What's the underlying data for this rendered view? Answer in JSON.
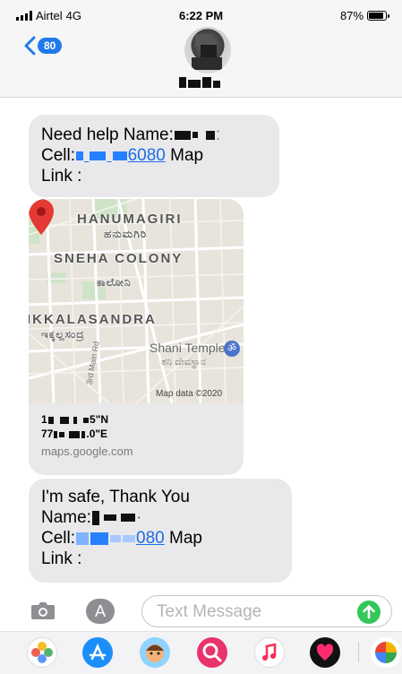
{
  "status_bar": {
    "carrier": "Airtel",
    "network": "4G",
    "time": "6:22 PM",
    "battery": "87%",
    "battery_level": 0.87
  },
  "header": {
    "back_count": "80"
  },
  "messages": {
    "first": {
      "line1_prefix": "Need help Name:",
      "line2_prefix": "Cell:",
      "phone_suffix": "6080",
      "line2_suffix": "Map",
      "line3": "Link :"
    },
    "map": {
      "labels": {
        "hanumagiri": "HANUMAGIRI",
        "hanumagiri_kn": "ಹನುಮಗಿರಿ",
        "sneha": "SNEHA COLONY",
        "sneha_kn": "ಕಾಲೋನಿ",
        "ikkalasandra": "IKKALASANDRA",
        "ikkalasandra_kn": "ಇಕ್ಕಲ್ಲಸಂದ್ರ",
        "temple": "Shani Temple",
        "temple_kn": "ಶನಿ ದೇವಸ್ಥಾನ",
        "road": "3rd Main Rd",
        "map_data": "Map data ©2020"
      },
      "lat_suffix": "5\"N",
      "lon_prefix": "77",
      "lon_suffix": ".0\"E",
      "domain": "maps.google.com"
    },
    "second": {
      "line1": "I'm safe, Thank You",
      "line2_prefix": "Name:",
      "line3_prefix": "Cell:",
      "phone_suffix": "080",
      "line3_suffix": "Map",
      "line4": "Link :"
    }
  },
  "input": {
    "placeholder": "Text Message"
  },
  "colors": {
    "link": "#1a6ee9",
    "bubble": "#e9e9eb",
    "send": "#34c759",
    "badge": "#1f7aec"
  }
}
